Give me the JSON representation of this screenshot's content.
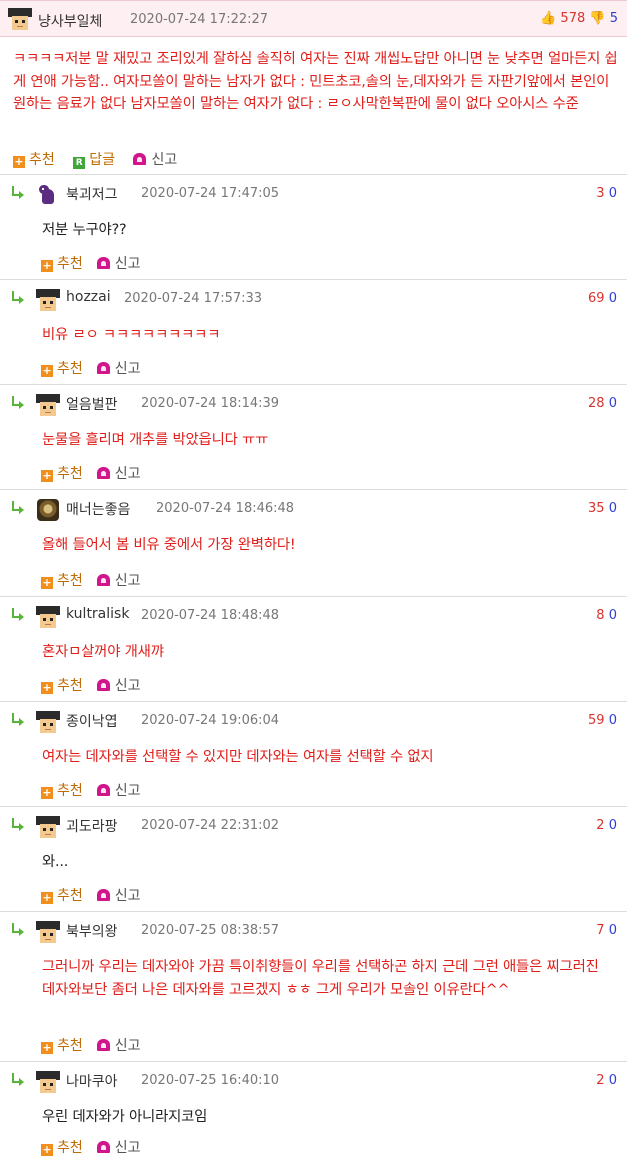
{
  "post": {
    "nickname": "냥사부일체",
    "date": "2020-07-24 17:22:27",
    "upvotes": "578",
    "downvotes": "5",
    "body": "ㅋㅋㅋㅋ저분 말 재밌고 조리있게 잘하심 솔직히 여자는 진짜 개씹노답만 아니면 눈 낮추면 얼마든지 쉽게 연애 가능함.. 여자모쏠이 말하는 남자가 없다 : 민트초코,솔의 눈,데자와가 든 자판기앞에서 본인이 원하는 음료가 없다 남자모쏠이 말하는 여자가 없다 : ㄹㅇ사막한복판에 물이 없다 오아시스 수준",
    "actions": {
      "recommend": "추천",
      "reply": "답글",
      "report": "신고"
    }
  },
  "comment_actions": {
    "recommend": "추천",
    "report": "신고"
  },
  "comments": [
    {
      "nickname": "북괴저그",
      "date": "2020-07-24 17:47:05",
      "up": "3",
      "down": "0",
      "body": "저분 누구야??"
    },
    {
      "nickname": "hozzai",
      "date": "2020-07-24 17:57:33",
      "up": "69",
      "down": "0",
      "body": "비유 ㄹㅇ ㅋㅋㅋㅋㅋㅋㅋㅋㅋ"
    },
    {
      "nickname": "얼음벌판",
      "date": "2020-07-24 18:14:39",
      "up": "28",
      "down": "0",
      "body": "눈물을 흘리며 개추를 박았읍니다 ㅠㅠ"
    },
    {
      "nickname": "매너는좋음",
      "date": "2020-07-24 18:46:48",
      "up": "35",
      "down": "0",
      "body": "올해 들어서 봄 비유 중에서 가장 완벽하다!"
    },
    {
      "nickname": "kultralisk",
      "date": "2020-07-24 18:48:48",
      "up": "8",
      "down": "0",
      "body": "혼자ㅁ살꺼야 개새꺄"
    },
    {
      "nickname": "종이낙엽",
      "date": "2020-07-24 19:06:04",
      "up": "59",
      "down": "0",
      "body": "여자는 데자와를 선택할 수 있지만 데자와는 여자를 선택할 수 없지"
    },
    {
      "nickname": "괴도라팡",
      "date": "2020-07-24 22:31:02",
      "up": "2",
      "down": "0",
      "body": "와..."
    },
    {
      "nickname": "북부의왕",
      "date": "2020-07-25 08:38:57",
      "up": "7",
      "down": "0",
      "body": "그러니까 우리는 데자와야 가끔 특이취향들이 우리를 선택하곤 하지 근데 그런 애들은 찌그러진 데자와보단 좀더 나은 데자와를 고르겠지 ㅎㅎ 그게 우리가 모솔인 이유란다^^"
    },
    {
      "nickname": "나마쿠아",
      "date": "2020-07-25 16:40:10",
      "up": "2",
      "down": "0",
      "body": "우린 데자와가 아니라지코임"
    }
  ]
}
